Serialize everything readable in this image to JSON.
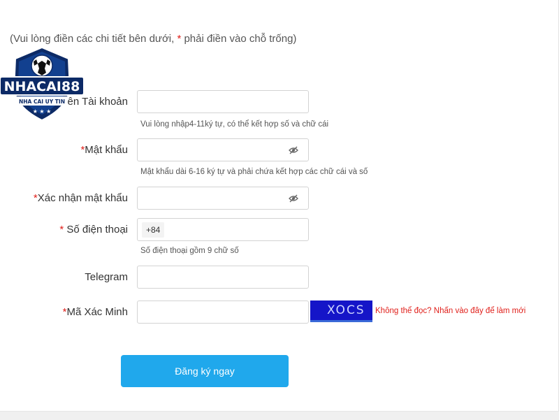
{
  "instructions": {
    "prefix": "(Vui lòng điền các chi tiết bên dưới, ",
    "asterisk": "*",
    "suffix": " phải điền vào chỗ trống)"
  },
  "logo": {
    "brand": "NHACAI88",
    "tagline": "NHA CAI UY TIN"
  },
  "form": {
    "username": {
      "label": "ên Tài khoản",
      "hint": "Vui lòng nhập4-11ký tự, có thể kết hợp số và chữ cái",
      "value": ""
    },
    "password": {
      "asterisk": "*",
      "label": "Mật khẩu",
      "hint": "Mật khẩu dài 6-16 ký tự và phải chứa kết hợp các chữ cái và số",
      "value": "",
      "icon": "eye-slash-icon"
    },
    "confirm_password": {
      "asterisk": "*",
      "label": "Xác nhận mật khẩu",
      "value": "",
      "icon": "eye-slash-icon"
    },
    "phone": {
      "asterisk": "* ",
      "label": "Số điện thoại",
      "prefix": "+84",
      "hint": "Số điện thoại gồm 9 chữ số",
      "value": ""
    },
    "telegram": {
      "label": "Telegram",
      "value": ""
    },
    "captcha": {
      "asterisk": "*",
      "label": "Mã Xác Minh",
      "value": "",
      "image_text": "XOCS",
      "refresh_link": "Không thể đọc? Nhấn vào đây để làm mới"
    },
    "submit_label": "Đăng ký ngay"
  },
  "colors": {
    "accent": "#20a8ec",
    "required": "#e0201b",
    "captcha_bg": "#1515c8"
  }
}
